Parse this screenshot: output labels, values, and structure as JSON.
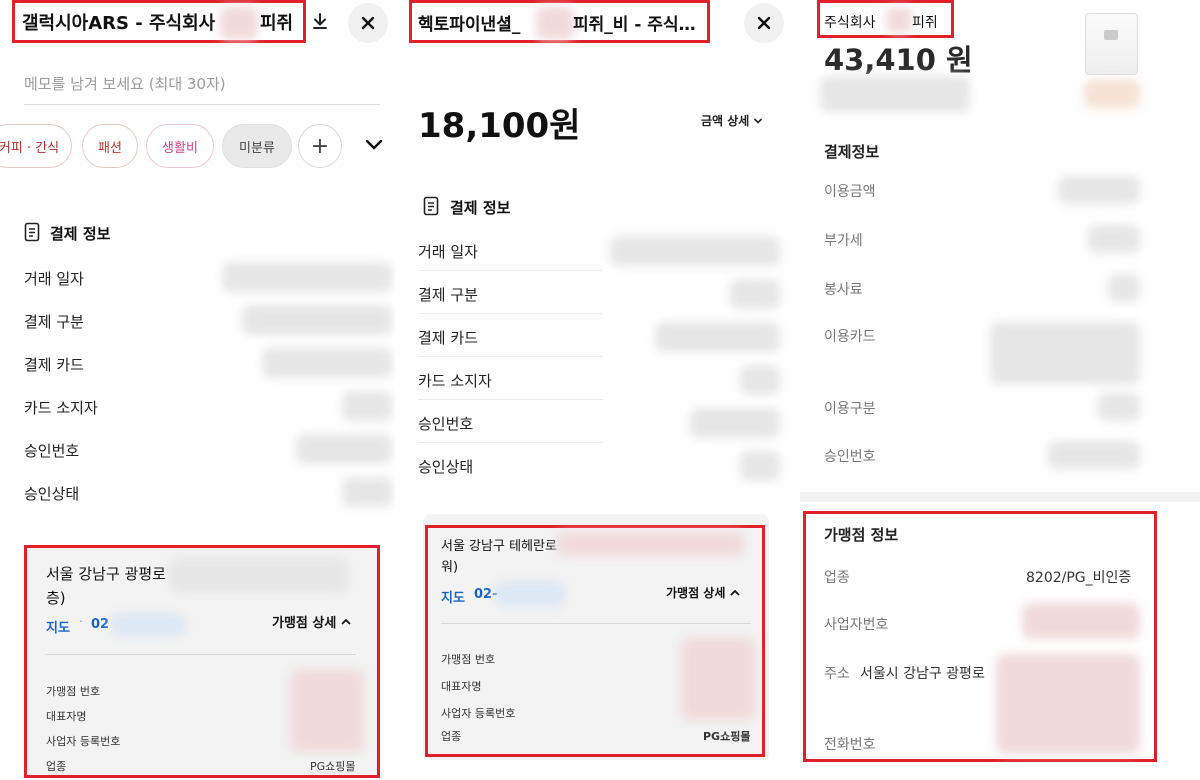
{
  "panel1": {
    "title_start": "갤럭시아ARS - 주식회사",
    "title_end": "피쥐",
    "memo_placeholder": "메모를 남겨 보세요 (최대 30자)",
    "chips": [
      "커피 · 간식",
      "패션",
      "생활비",
      "미분류",
      "+"
    ],
    "section_title": "결제 정보",
    "rows": [
      "거래 일자",
      "결제 구분",
      "결제 카드",
      "카드 소지자",
      "승인번호",
      "승인상태"
    ],
    "merchant": {
      "address_start": "서울 강남구 광평로",
      "address_end": "층)",
      "map_label": "지도",
      "phone_prefix": "02",
      "detail_label": "가맹점 상세",
      "fields": [
        "가맹점 번호",
        "대표자명",
        "사업자 등록번호",
        "업종"
      ],
      "category_value": "PG쇼핑몰"
    }
  },
  "panel2": {
    "title": "헥토파이낸셜_",
    "title_mid": "피쥐_비 - 주식…",
    "amount": "18,100원",
    "amount_detail": "금액 상세",
    "section_title": "결제 정보",
    "rows": [
      "거래 일자",
      "결제 구분",
      "결제 카드",
      "카드 소지자",
      "승인번호",
      "승인상태"
    ],
    "merchant": {
      "address_start": "서울 강남구 테헤란로",
      "address_end": "워)",
      "map_label": "지도",
      "phone_prefix": "02-",
      "detail_label": "가맹점 상세",
      "fields": [
        "가맹점 번호",
        "대표자명",
        "사업자 등록번호",
        "업종"
      ],
      "category_value": "PG쇼핑몰"
    }
  },
  "panel3": {
    "title_start": "주식회사",
    "title_end": "피쥐",
    "amount": "43,410 원",
    "section_title": "결제정보",
    "rows": [
      "이용금액",
      "부가세",
      "봉사료",
      "이용카드",
      "이용구분",
      "승인번호"
    ],
    "merchant": {
      "section_title": "가맹점 정보",
      "business_type_label": "업종",
      "business_type_value": "8202/PG_비인증",
      "business_no_label": "사업자번호",
      "address_label": "주소",
      "address_value": "서울시 강남구 광평로",
      "phone_label": "전화번호"
    }
  },
  "colors": {
    "highlight": "#e0202a",
    "link_blue": "#1a63c6"
  },
  "icons": {
    "download": "download-icon",
    "close": "close-icon",
    "chevron": "chevron-down-icon",
    "document": "document-icon"
  }
}
